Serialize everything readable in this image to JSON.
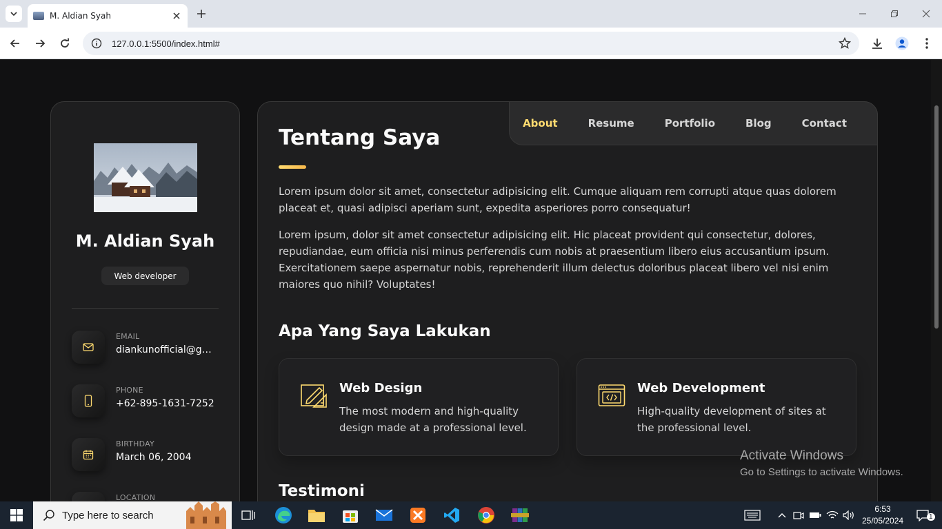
{
  "browser": {
    "tab_title": "M. Aldian Syah",
    "url": "127.0.0.1:5500/index.html#"
  },
  "sidebar": {
    "name": "M. Aldian Syah",
    "role": "Web developer",
    "contacts": [
      {
        "icon": "mail-icon",
        "label": "EMAIL",
        "value": "diankunofficial@gmail.com"
      },
      {
        "icon": "phone-icon",
        "label": "PHONE",
        "value": "+62-895-1631-7252"
      },
      {
        "icon": "calendar-icon",
        "label": "BIRTHDAY",
        "value": "March 06, 2004"
      },
      {
        "icon": "location-icon",
        "label": "LOCATION",
        "value": ""
      }
    ]
  },
  "nav": {
    "items": [
      "About",
      "Resume",
      "Portfolio",
      "Blog",
      "Contact"
    ],
    "active": "About"
  },
  "about": {
    "title": "Tentang Saya",
    "paragraphs": [
      "Lorem ipsum dolor sit amet, consectetur adipisicing elit. Cumque aliquam rem corrupti atque quas dolorem placeat et, quasi adipisci aperiam sunt, expedita asperiores porro consequatur!",
      "Lorem ipsum, dolor sit amet consectetur adipisicing elit. Hic placeat provident qui consectetur, dolores, repudiandae, eum officia nisi minus perferendis cum nobis at praesentium libero eius accusantium ipsum. Exercitationem saepe aspernatur nobis, reprehenderit illum delectus doloribus placeat libero vel nisi enim maiores quo nihil? Voluptates!"
    ],
    "services_title": "Apa Yang Saya Lakukan",
    "services": [
      {
        "icon": "design-icon",
        "title": "Web Design",
        "text": "The most modern and high-quality design made at a professional level."
      },
      {
        "icon": "code-icon",
        "title": "Web Development",
        "text": "High-quality development of sites at the professional level."
      }
    ],
    "testimonials_title": "Testimoni"
  },
  "watermark": {
    "title": "Activate Windows",
    "subtitle": "Go to Settings to activate Windows."
  },
  "taskbar": {
    "search_placeholder": "Type here to search",
    "time": "6:53",
    "date": "25/05/2024",
    "notification_count": "1"
  },
  "colors": {
    "accent": "#ffdb70",
    "background": "#121212",
    "card": "#1e1e1f"
  }
}
